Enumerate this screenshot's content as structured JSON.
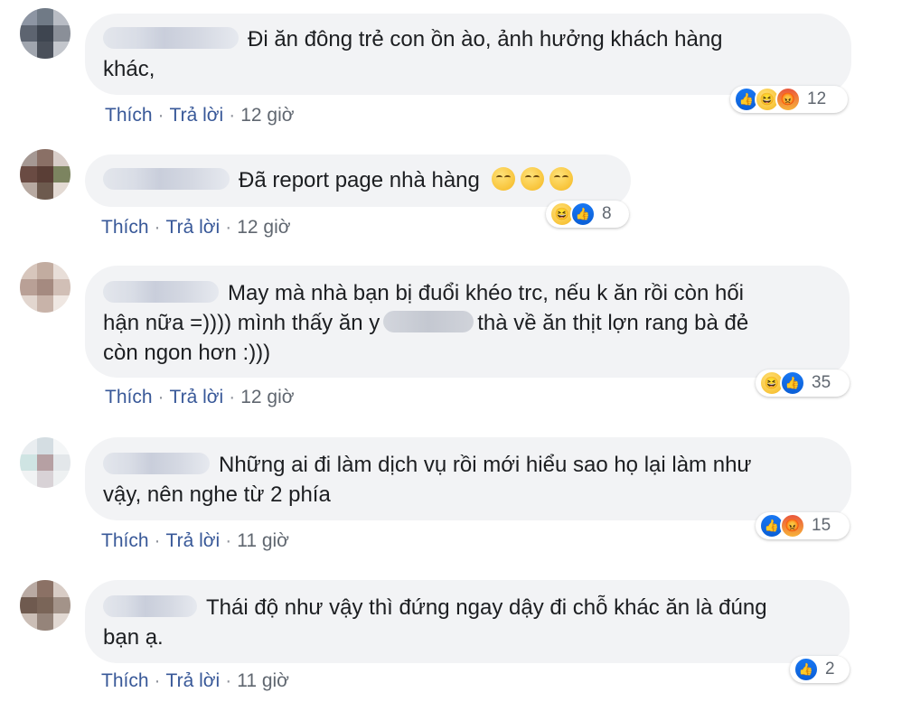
{
  "colors": {
    "link": "#385898",
    "bubble": "#f2f3f5",
    "meta": "#606770",
    "like_blue": "#1877f2",
    "haha_yellow": "#f8c43a",
    "angry_orange": "#e9573c"
  },
  "actions": {
    "like": "Thích",
    "reply": "Trả lời",
    "separator": "·"
  },
  "comments": [
    {
      "lines": [
        "Đi ăn đông trẻ con ồn ào, ảnh hưởng khách hàng",
        "khác,"
      ],
      "reactions": [
        "like-icon",
        "haha-icon",
        "angry-icon"
      ],
      "reaction_count": "12",
      "time": "12 giờ"
    },
    {
      "lines": [
        "Đã report page nhà hàng"
      ],
      "emoji": [
        "relieved-face",
        "relieved-face",
        "relieved-face"
      ],
      "reactions": [
        "haha-icon",
        "like-icon"
      ],
      "reaction_count": "8",
      "time": "12 giờ"
    },
    {
      "line1": "May mà nhà bạn bị đuổi khéo trc, nếu k ăn rồi còn hối",
      "line2_a": "hận nữa =)))) mình thấy ăn y",
      "line2_b": "thà về ăn thịt lợn rang bà đẻ",
      "line3": "còn ngon hơn :)))",
      "reactions": [
        "haha-icon",
        "like-icon"
      ],
      "reaction_count": "35",
      "time": "12 giờ"
    },
    {
      "lines": [
        "Những ai đi làm dịch vụ rồi mới hiểu sao họ lại làm như",
        "vậy, nên nghe từ 2 phía"
      ],
      "reactions": [
        "like-icon",
        "angry-icon"
      ],
      "reaction_count": "15",
      "time": "11 giờ"
    },
    {
      "lines": [
        "Thái độ như vậy thì đứng ngay dậy đi chỗ khác ăn là đúng",
        "bạn ạ."
      ],
      "reactions": [
        "like-icon"
      ],
      "reaction_count": "2",
      "time": "11 giờ"
    }
  ]
}
